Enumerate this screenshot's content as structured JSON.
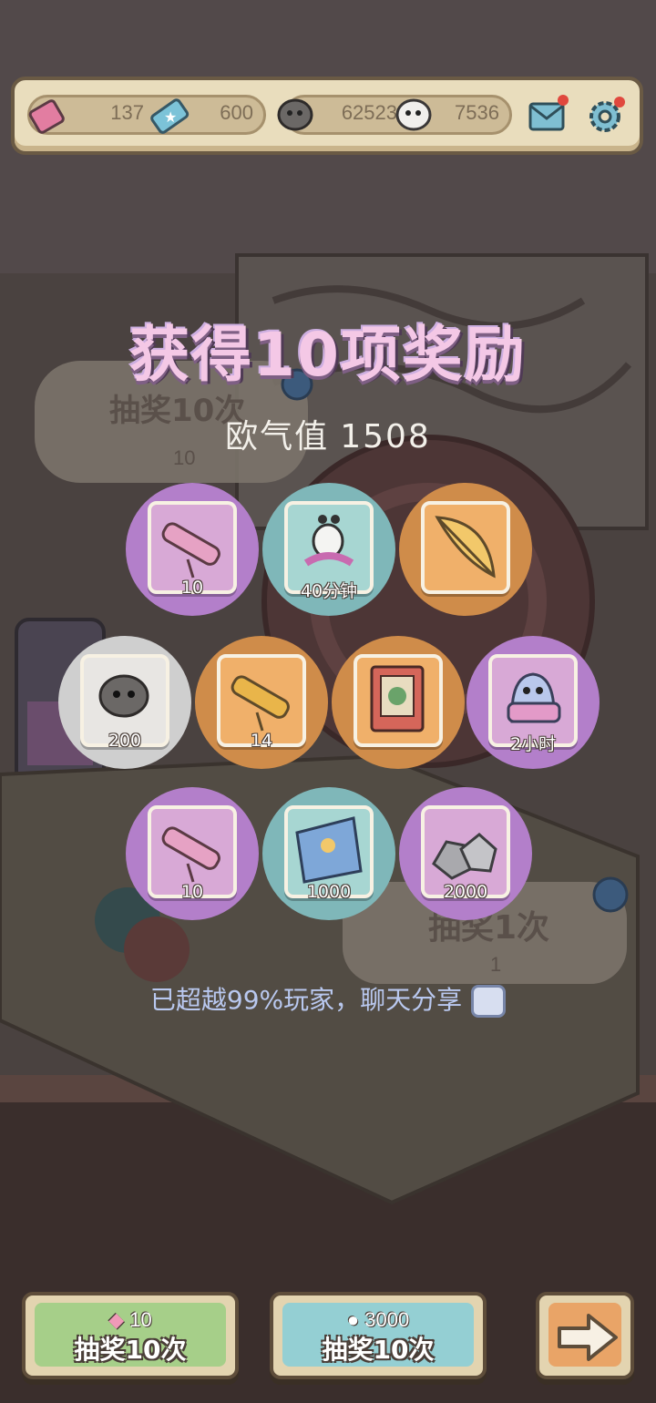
{
  "resources": {
    "tickets": "137",
    "stars": "600",
    "gray_spirits": "62523",
    "white_spirits": "7536"
  },
  "header": {
    "title": "获得10项奖励",
    "luck_label": "欧气值",
    "luck_value": "1508"
  },
  "background": {
    "left_draw_label": "抽奖10次",
    "left_draw_cost": "10",
    "right_draw_label": "抽奖1次",
    "right_draw_cost": "1"
  },
  "rewards": [
    {
      "name": "pink-telescope",
      "count": "10",
      "rarity": "purple"
    },
    {
      "name": "ghost-worm",
      "count": "40分钟",
      "rarity": "teal"
    },
    {
      "name": "golden-feather",
      "count": "",
      "rarity": "orange"
    },
    {
      "name": "gray-spirit",
      "count": "200",
      "rarity": "white"
    },
    {
      "name": "golden-telescope",
      "count": "14",
      "rarity": "orange"
    },
    {
      "name": "storybook",
      "count": "",
      "rarity": "orange"
    },
    {
      "name": "blanket-ghost",
      "count": "2小时",
      "rarity": "purple"
    },
    {
      "name": "pink-telescope",
      "count": "10",
      "rarity": "purple"
    },
    {
      "name": "blue-map",
      "count": "1000",
      "rarity": "teal"
    },
    {
      "name": "stones",
      "count": "2000",
      "rarity": "purple"
    }
  ],
  "share_text": "已超越99%玩家，聊天分享",
  "buttons": {
    "ticket_cost": "10",
    "ticket_label": "抽奖10次",
    "spirit_cost": "3000",
    "spirit_label": "抽奖10次"
  },
  "colors": {
    "purple_ring": "#b37fca",
    "teal_ring": "#7fb7b9",
    "orange_ring": "#cf8c4a",
    "white_ring": "#cfcfcf"
  }
}
